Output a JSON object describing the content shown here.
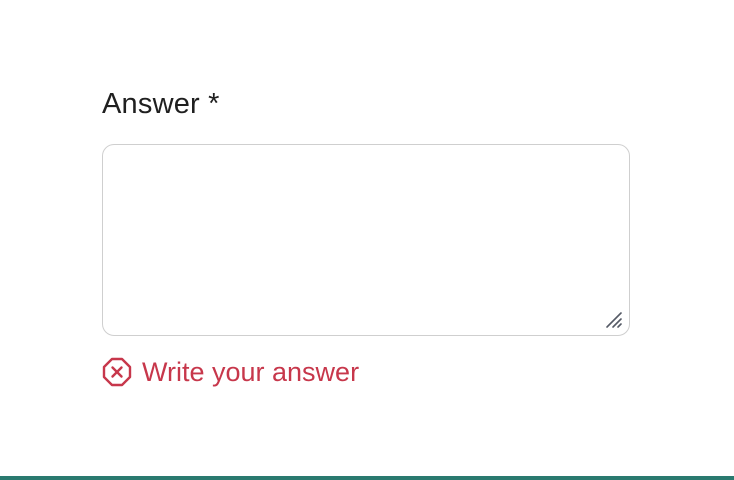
{
  "field": {
    "label": "Answer *",
    "value": "",
    "placeholder": ""
  },
  "error": {
    "message": "Write your answer",
    "icon": "error-circle-x-icon"
  },
  "colors": {
    "error": "#c7374b",
    "bottom_bar": "#2a7a6f",
    "border": "#cfcfcf"
  }
}
